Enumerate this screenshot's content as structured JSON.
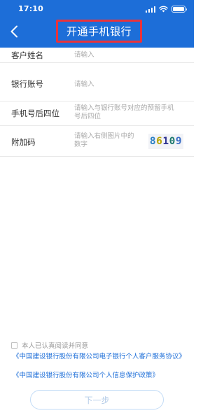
{
  "status_bar": {
    "time": "17:10"
  },
  "header": {
    "title": "开通手机银行"
  },
  "form": {
    "customer_name": {
      "label": "客户姓名",
      "placeholder": "请输入"
    },
    "account_number": {
      "label": "银行账号",
      "placeholder": "请输入"
    },
    "phone_last_four": {
      "label": "手机号后四位",
      "placeholder_lines": [
        "请输入与银行账号对应的预留手机",
        "号后四位"
      ]
    },
    "captcha": {
      "label": "附加码",
      "placeholder_lines": [
        "请输入右侧图片中的",
        "数字"
      ],
      "digits": [
        "8",
        "6",
        "1",
        "0",
        "9"
      ],
      "digit_colors": [
        "#2a7fc4",
        "#b8a300",
        "#2d3190",
        "#1f7a6e",
        "#3a6ec6"
      ]
    }
  },
  "agreement": {
    "text": "本人已认真阅读并同意",
    "links": [
      "《中国建设银行股份有限公司电子银行个人客户服务协议》",
      "《中国建设银行股份有限公司个人信息保护政策》"
    ]
  },
  "next_button": {
    "label": "下一步"
  },
  "colors": {
    "primary": "#1d6ed8",
    "highlight": "#e8333c",
    "link": "#1d6ed8"
  }
}
